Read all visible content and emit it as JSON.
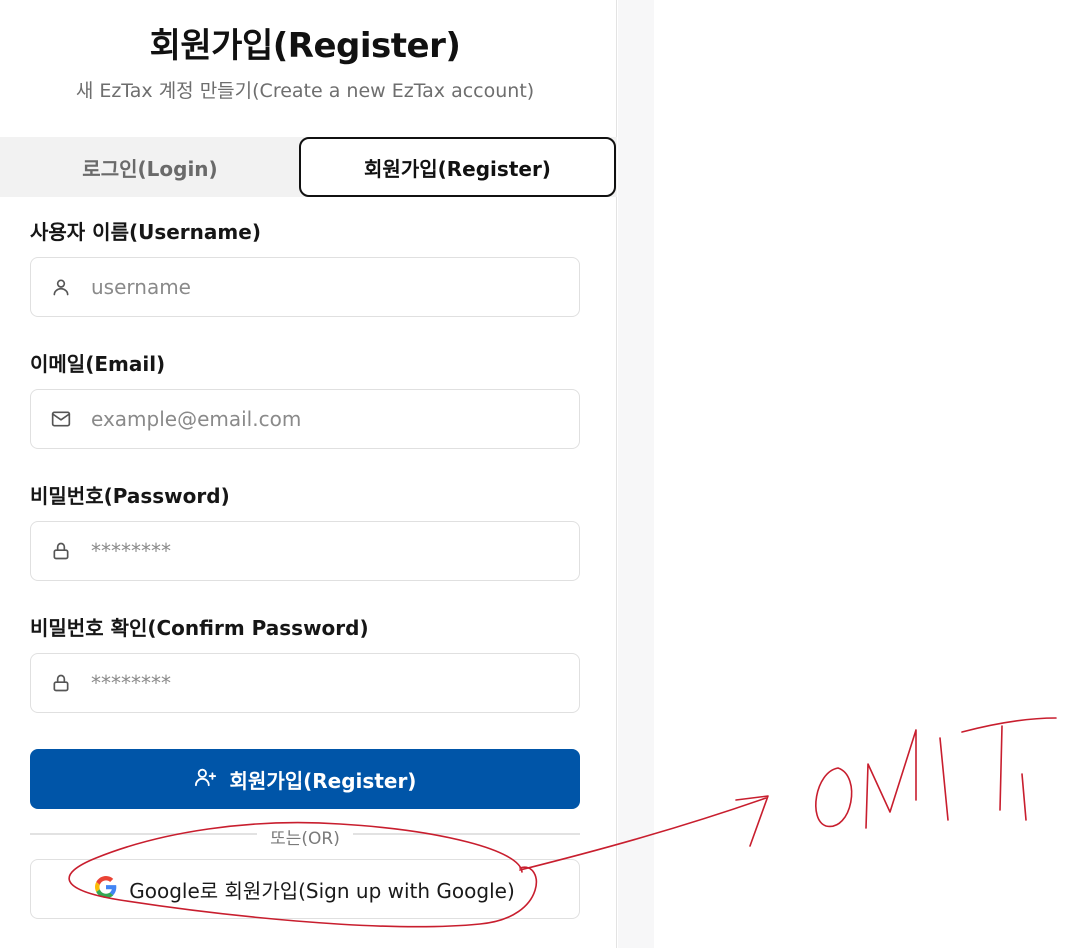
{
  "header": {
    "title": "회원가입(Register)",
    "subtitle": "새 EzTax 계정 만들기(Create a new EzTax account)"
  },
  "tabs": [
    {
      "label": "로그인(Login)",
      "active": false
    },
    {
      "label": "회원가입(Register)",
      "active": true
    }
  ],
  "form": {
    "username": {
      "label": "사용자 이름(Username)",
      "placeholder": "username",
      "icon": "user-icon"
    },
    "email": {
      "label": "이메일(Email)",
      "placeholder": "example@email.com",
      "icon": "mail-icon"
    },
    "password": {
      "label": "비밀번호(Password)",
      "placeholder": "********",
      "icon": "lock-icon"
    },
    "confirm_password": {
      "label": "비밀번호 확인(Confirm Password)",
      "placeholder": "********",
      "icon": "lock-icon"
    }
  },
  "register_button": {
    "label": "회원가입(Register)",
    "icon": "user-plus-icon"
  },
  "divider": {
    "label": "또는(OR)"
  },
  "google_button": {
    "label": "Google로 회원가입(Sign up with Google)",
    "icon": "google-logo-icon"
  },
  "annotation": {
    "handwritten_text": "OMIT",
    "color": "#c81e2e"
  },
  "colors": {
    "primary": "#0055a8",
    "active_tab_border": "#111111",
    "tab_bar_bg": "#f2f2f2"
  }
}
